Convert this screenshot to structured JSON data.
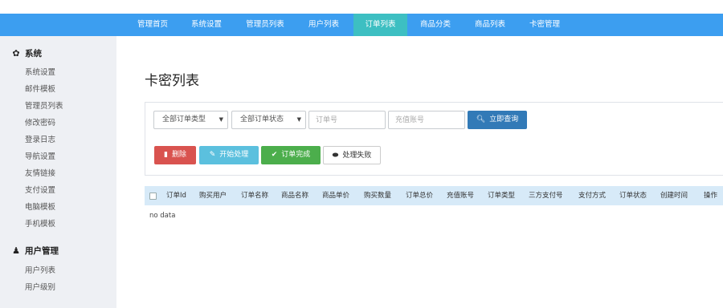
{
  "navbar": {
    "items": [
      {
        "label": "管理首页",
        "active": false
      },
      {
        "label": "系统设置",
        "active": false
      },
      {
        "label": "管理员列表",
        "active": false
      },
      {
        "label": "用户列表",
        "active": false
      },
      {
        "label": "订单列表",
        "active": true
      },
      {
        "label": "商品分类",
        "active": false
      },
      {
        "label": "商品列表",
        "active": false
      },
      {
        "label": "卡密管理",
        "active": false
      }
    ]
  },
  "sidebar": {
    "system": {
      "icon": "gear-icon",
      "title": "系统",
      "items": [
        "系统设置",
        "邮件模板",
        "管理员列表",
        "修改密码",
        "登录日志",
        "导航设置",
        "友情链接",
        "支付设置",
        "电脑模板",
        "手机模板"
      ]
    },
    "users": {
      "icon": "user-icon",
      "title": "用户管理",
      "items": [
        "用户列表",
        "用户级别"
      ]
    }
  },
  "main": {
    "title": "卡密列表",
    "filters": {
      "order_type": "全部订单类型",
      "order_status": "全部订单状态",
      "order_no_placeholder": "订单号",
      "account_placeholder": "充值账号",
      "query_label": "立即查询"
    },
    "actions": {
      "delete_label": "删除",
      "start_label": "开始处理",
      "done_label": "订单完成",
      "fail_label": "处理失败"
    },
    "table": {
      "columns": [
        "订单Id",
        "购买用户",
        "订单名称",
        "商品名称",
        "商品单价",
        "购买数量",
        "订单总价",
        "充值账号",
        "订单类型",
        "三方支付号",
        "支付方式",
        "订单状态",
        "创建时间",
        "操作"
      ],
      "empty_text": "no data"
    }
  },
  "colors": {
    "navbar": "#3c9ef0",
    "nav_active": "#3dbfc2",
    "sidebar": "#eef0f4",
    "table_header": "#d7eaf8",
    "btn_primary": "#327ab7",
    "btn_danger": "#d9534f",
    "btn_info": "#5bc0de",
    "btn_success": "#4cae4c"
  }
}
